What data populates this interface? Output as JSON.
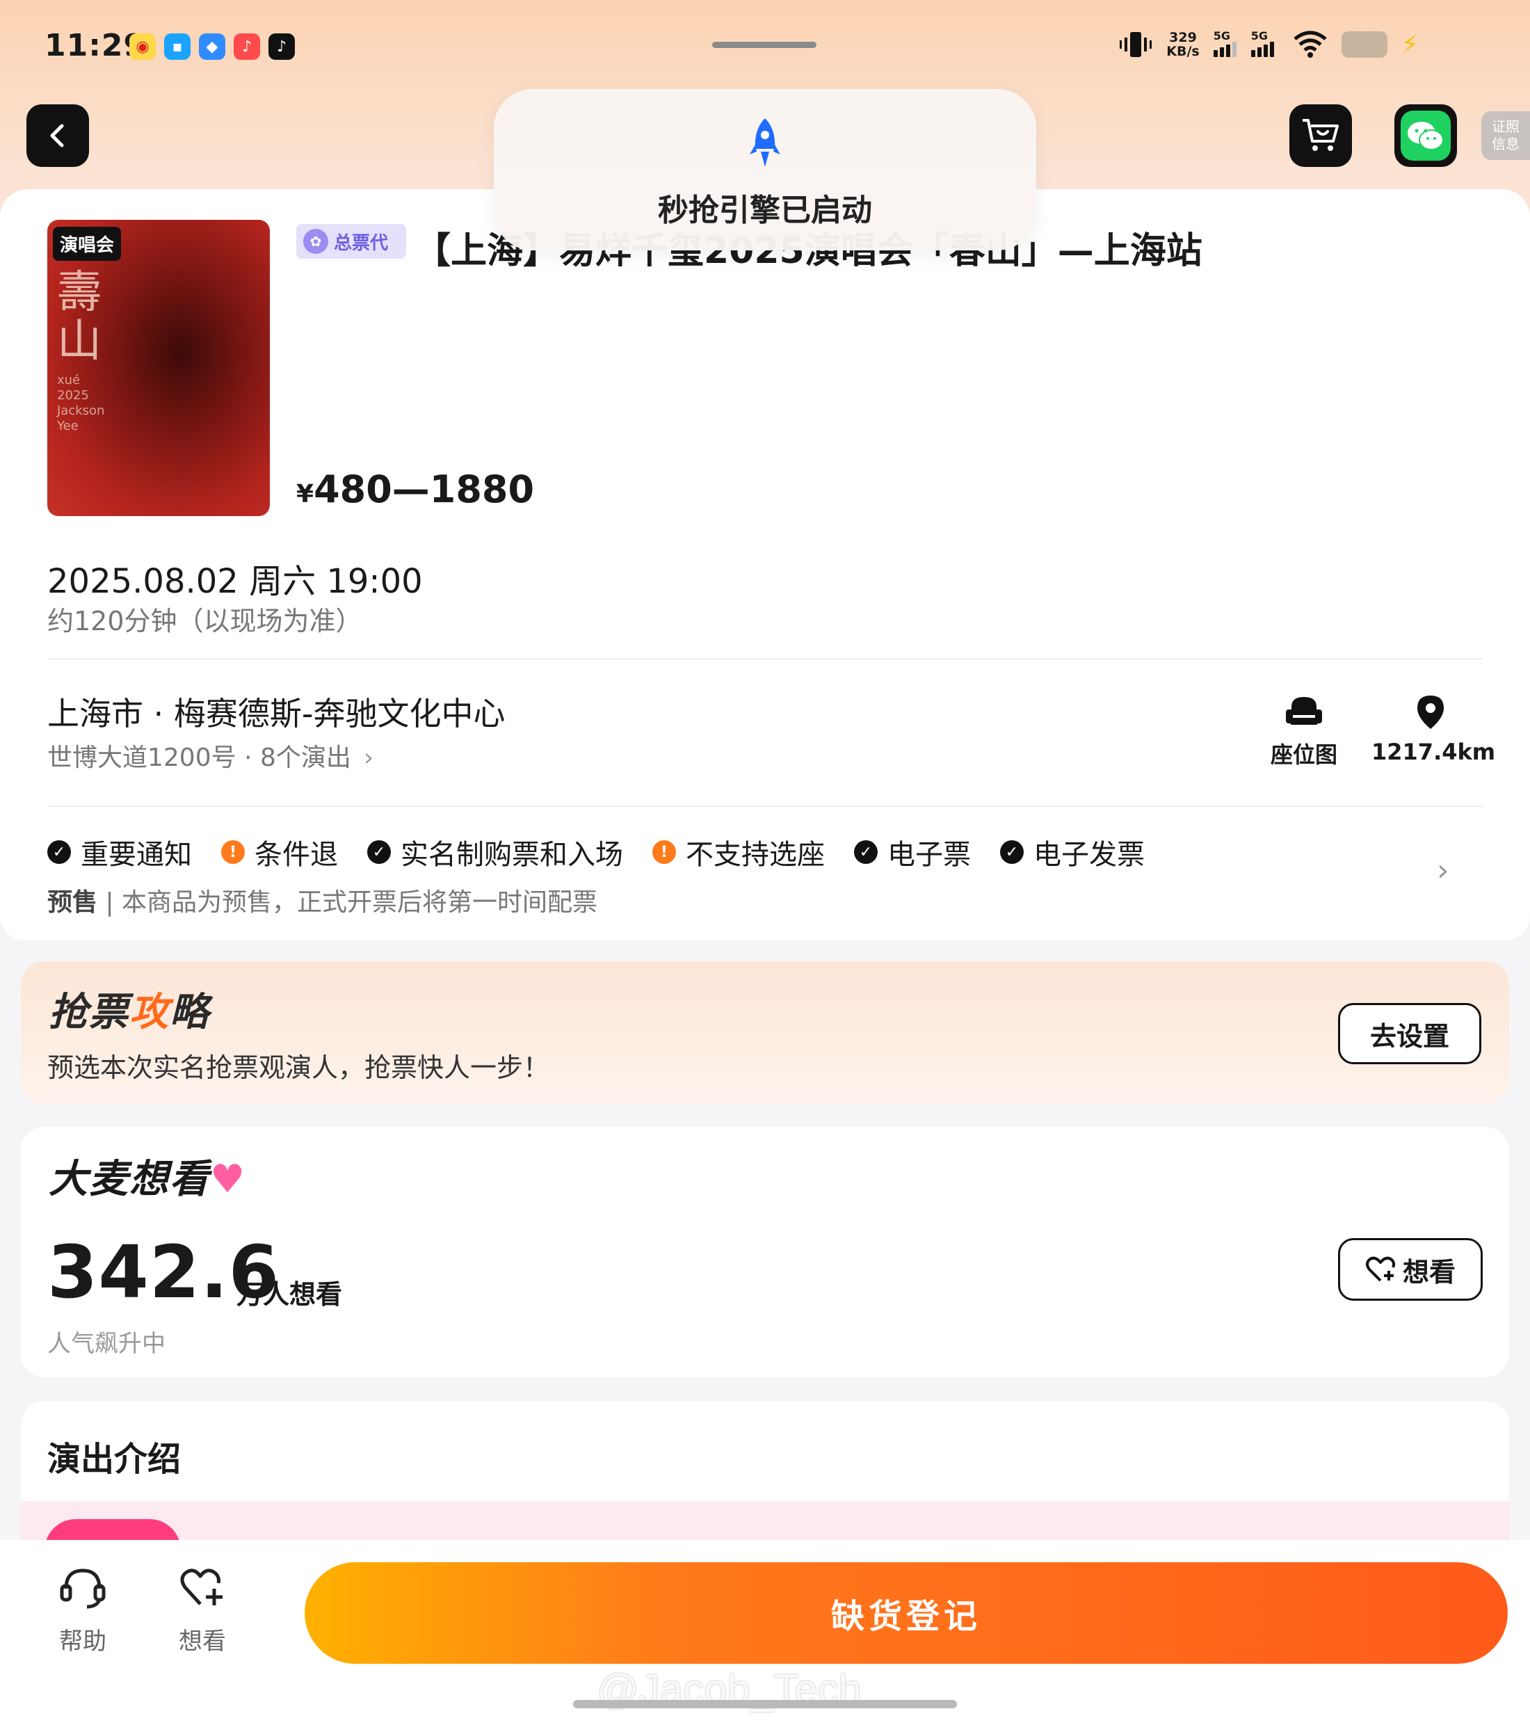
{
  "status_bar": {
    "time": "11:29",
    "net_speed_value": "329",
    "net_speed_unit": "KB/s",
    "sig1_label": "5G",
    "sig2_label": "5G"
  },
  "header": {
    "license_line1": "证照",
    "license_line2": "信息"
  },
  "toast": {
    "message": "秒抢引擎已启动"
  },
  "event": {
    "poster_tag": "演唱会",
    "agent_badge": "总票代",
    "title": "【上海】易烊千玺2025演唱会「春山」—上海站",
    "price_yen": "¥",
    "price_range": "480—1880",
    "datetime": "2025.08.02 周六 19:00",
    "duration": "约120分钟（以现场为准）",
    "venue_name": "上海市 · 梅赛德斯-奔驰文化中心",
    "venue_address": "世博大道1200号 · 8个演出",
    "seat_map_label": "座位图",
    "distance": "1217.4km"
  },
  "notices": [
    {
      "label": "重要通知",
      "type": "ok"
    },
    {
      "label": "条件退",
      "type": "warn"
    },
    {
      "label": "实名制购票和入场",
      "type": "ok"
    },
    {
      "label": "不支持选座",
      "type": "warn"
    },
    {
      "label": "电子票",
      "type": "ok"
    },
    {
      "label": "电子发票",
      "type": "ok"
    }
  ],
  "presale": {
    "tag": "预售",
    "text": "本商品为预售，正式开票后将第一时间配票"
  },
  "strategy": {
    "title_a": "抢票",
    "title_b": "攻",
    "title_c": "略",
    "desc": "预选本次实名抢票观演人，抢票快人一步！",
    "button": "去设置"
  },
  "wishlist": {
    "title_a": "大麦想",
    "title_b": "看",
    "count": "342.6",
    "unit": "万人想看",
    "trend": "人气飙升中",
    "button": "想看"
  },
  "intro": {
    "title": "演出介绍"
  },
  "bottom_bar": {
    "help_label": "帮助",
    "want_label": "想看",
    "register_button": "缺货登记"
  },
  "watermark": "@Jacob_Tech",
  "colors": {
    "accent": "#ff6a1a",
    "warn": "#ff7a1a",
    "wechat": "#1fd160",
    "pink": "#ff3c7d"
  }
}
